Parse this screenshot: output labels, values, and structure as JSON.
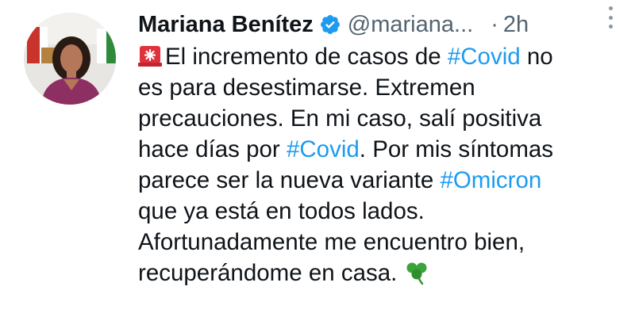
{
  "author": {
    "name": "Mariana Benítez",
    "handle": "@mariana...",
    "separator": "·",
    "time": "2h"
  },
  "tweet": {
    "line1_text": "El incremento de casos de ",
    "line1_hashtag": "#Covid",
    "line1_end": " no",
    "line2": "es para desestimarse. Extremen",
    "line3": "precauciones. En mi caso, salí positiva",
    "line4_text": "hace días por ",
    "line4_hashtag": "#Covid",
    "line4_end": ". Por mis síntomas",
    "line5_text": "parece ser la nueva variante ",
    "line5_hashtag": "#Omicron",
    "line6": "que ya está en todos lados.",
    "line7": "Afortunadamente me encuentro bien,",
    "line8": "recuperándome en casa."
  },
  "icons": {
    "lead_emoji": "siren-icon",
    "trail_emoji": "shamrock-icon",
    "badge": "verified-badge-icon",
    "menu": "more-options-icon"
  },
  "colors": {
    "hashtag": "#1d9bf0",
    "text": "#0f1419",
    "secondary": "#536471",
    "verified": "#1d9bf0"
  }
}
